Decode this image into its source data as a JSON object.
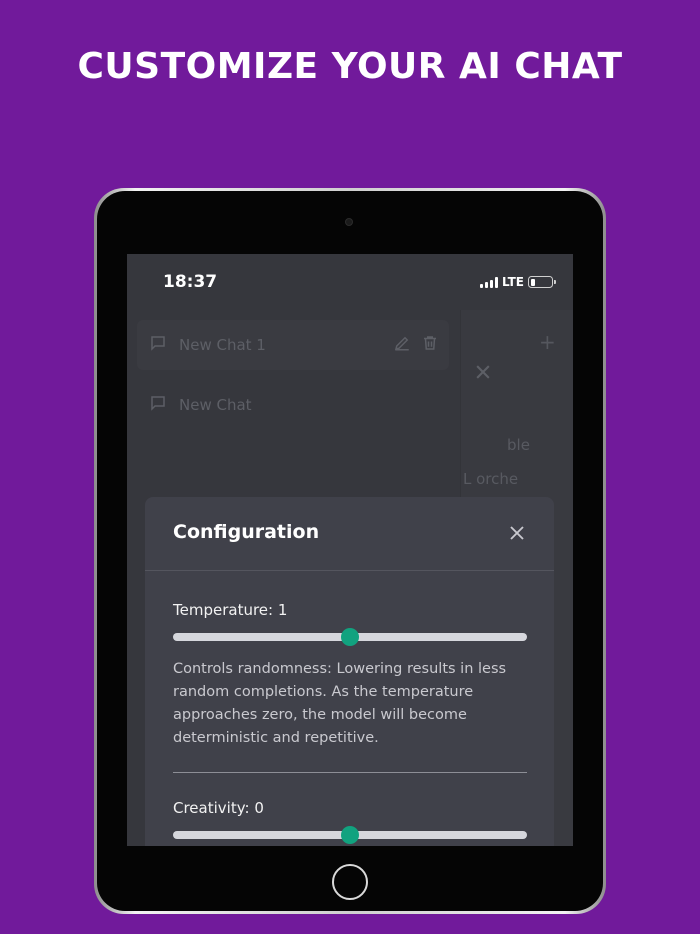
{
  "headline": "CUSTOMIZE YOUR AI CHAT",
  "status_bar": {
    "time": "18:37",
    "network": "LTE",
    "battery_level": 0.2
  },
  "sidebar": {
    "chats": [
      {
        "label": "New Chat 1",
        "active": true
      },
      {
        "label": "New Chat",
        "active": false
      }
    ]
  },
  "side_panel": {
    "text1": "ble",
    "text2": "L orche"
  },
  "modal": {
    "title": "Configuration",
    "temperature": {
      "label": "Temperature: 1",
      "value": 1,
      "range": [
        0,
        2
      ],
      "description": "Controls randomness: Lowering results in less random completions. As the temperature approaches zero, the model will become deterministic and repetitive."
    },
    "creativity": {
      "label": "Creativity: 0",
      "value": 0,
      "range": [
        -2,
        2
      ]
    }
  },
  "colors": {
    "background": "#711a9b",
    "accent": "#11a27f",
    "modal": "#40414a",
    "screen": "#36373d"
  }
}
